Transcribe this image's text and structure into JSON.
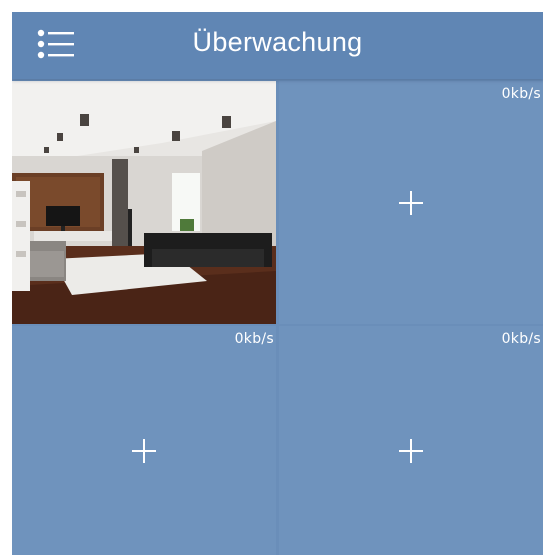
{
  "header": {
    "title": "Überwachung",
    "menu_icon": "list-menu-icon"
  },
  "colors": {
    "header_bg": "#6086b4",
    "grid_bg": "#6f93bd",
    "text": "#ffffff"
  },
  "cameras": [
    {
      "preview": "living-room-camera-preview"
    },
    {
      "rate": "0kb/s",
      "add_icon": "plus-icon"
    },
    {
      "rate": "0kb/s",
      "add_icon": "plus-icon"
    },
    {
      "rate": "0kb/s",
      "add_icon": "plus-icon"
    }
  ]
}
